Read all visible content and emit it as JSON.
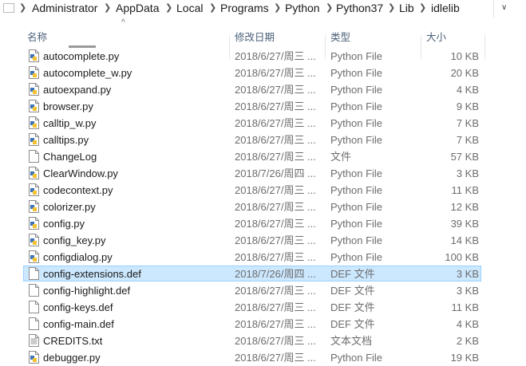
{
  "breadcrumb": {
    "items": [
      "Administrator",
      "AppData",
      "Local",
      "Programs",
      "Python",
      "Python37",
      "Lib",
      "idlelib"
    ]
  },
  "columns": {
    "name": "名称",
    "date": "修改日期",
    "type": "类型",
    "size": "大小"
  },
  "files": [
    {
      "name": "autocomplete.py",
      "date": "2018/6/27/周三 ...",
      "type": "Python File",
      "size": "10 KB",
      "icon": "python-file-icon"
    },
    {
      "name": "autocomplete_w.py",
      "date": "2018/6/27/周三 ...",
      "type": "Python File",
      "size": "20 KB",
      "icon": "python-file-icon"
    },
    {
      "name": "autoexpand.py",
      "date": "2018/6/27/周三 ...",
      "type": "Python File",
      "size": "4 KB",
      "icon": "python-file-icon"
    },
    {
      "name": "browser.py",
      "date": "2018/6/27/周三 ...",
      "type": "Python File",
      "size": "9 KB",
      "icon": "python-file-icon"
    },
    {
      "name": "calltip_w.py",
      "date": "2018/6/27/周三 ...",
      "type": "Python File",
      "size": "7 KB",
      "icon": "python-file-icon"
    },
    {
      "name": "calltips.py",
      "date": "2018/6/27/周三 ...",
      "type": "Python File",
      "size": "7 KB",
      "icon": "python-file-icon"
    },
    {
      "name": "ChangeLog",
      "date": "2018/6/27/周三 ...",
      "type": "文件",
      "size": "57 KB",
      "icon": "blank-file-icon"
    },
    {
      "name": "ClearWindow.py",
      "date": "2018/7/26/周四 ...",
      "type": "Python File",
      "size": "3 KB",
      "icon": "python-file-icon"
    },
    {
      "name": "codecontext.py",
      "date": "2018/6/27/周三 ...",
      "type": "Python File",
      "size": "11 KB",
      "icon": "python-file-icon"
    },
    {
      "name": "colorizer.py",
      "date": "2018/6/27/周三 ...",
      "type": "Python File",
      "size": "12 KB",
      "icon": "python-file-icon"
    },
    {
      "name": "config.py",
      "date": "2018/6/27/周三 ...",
      "type": "Python File",
      "size": "39 KB",
      "icon": "python-file-icon"
    },
    {
      "name": "config_key.py",
      "date": "2018/6/27/周三 ...",
      "type": "Python File",
      "size": "14 KB",
      "icon": "python-file-icon"
    },
    {
      "name": "configdialog.py",
      "date": "2018/6/27/周三 ...",
      "type": "Python File",
      "size": "100 KB",
      "icon": "python-file-icon"
    },
    {
      "name": "config-extensions.def",
      "date": "2018/7/26/周四 ...",
      "type": "DEF 文件",
      "size": "3 KB",
      "icon": "blank-file-icon",
      "selected": true
    },
    {
      "name": "config-highlight.def",
      "date": "2018/6/27/周三 ...",
      "type": "DEF 文件",
      "size": "3 KB",
      "icon": "blank-file-icon"
    },
    {
      "name": "config-keys.def",
      "date": "2018/6/27/周三 ...",
      "type": "DEF 文件",
      "size": "11 KB",
      "icon": "blank-file-icon"
    },
    {
      "name": "config-main.def",
      "date": "2018/6/27/周三 ...",
      "type": "DEF 文件",
      "size": "4 KB",
      "icon": "blank-file-icon"
    },
    {
      "name": "CREDITS.txt",
      "date": "2018/6/27/周三 ...",
      "type": "文本文档",
      "size": "2 KB",
      "icon": "text-file-icon"
    },
    {
      "name": "debugger.py",
      "date": "2018/6/27/周三 ...",
      "type": "Python File",
      "size": "19 KB",
      "icon": "python-file-icon"
    }
  ],
  "colors": {
    "selection_bg": "#cce8ff",
    "selection_border": "#99d1ff",
    "header_text": "#4c607a"
  }
}
